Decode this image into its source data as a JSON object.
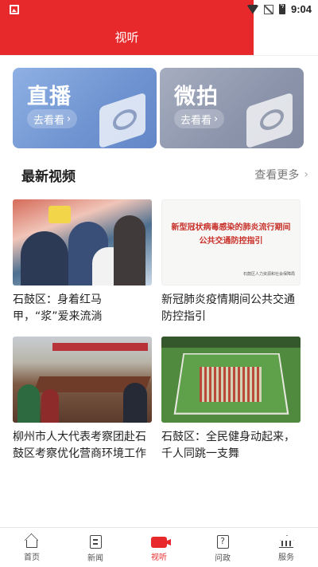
{
  "status_bar": {
    "time": "9:04"
  },
  "header": {
    "title": "视听"
  },
  "features": [
    {
      "title": "直播",
      "button": "去看看"
    },
    {
      "title": "微拍",
      "button": "去看看"
    }
  ],
  "section": {
    "title": "最新视频",
    "more": "查看更多"
  },
  "videos": [
    {
      "title": "石鼓区：身着红马甲，“浆”爱来流淌"
    },
    {
      "title": "新冠肺炎疫情期间公共交通防控指引",
      "thumb_headline_1": "新型冠状病毒感染的肺炎流行期间",
      "thumb_headline_2": "公共交通防控指引",
      "thumb_org": "石鼓区人力资源和社会保障局"
    },
    {
      "title": "柳州市人大代表考察团赴石鼓区考察优化营商环境工作"
    },
    {
      "title": "石鼓区：全民健身动起来，千人同跳一支舞"
    }
  ],
  "tabs": [
    {
      "label": "首页",
      "icon": "home-icon"
    },
    {
      "label": "新闻",
      "icon": "news-icon"
    },
    {
      "label": "视听",
      "icon": "video-icon",
      "active": true
    },
    {
      "label": "问政",
      "icon": "ask-icon"
    },
    {
      "label": "服务",
      "icon": "service-icon"
    }
  ],
  "colors": {
    "brand": "#e8292b",
    "live_card": "#7a9bd8",
    "micro_card": "#8f97ad"
  }
}
